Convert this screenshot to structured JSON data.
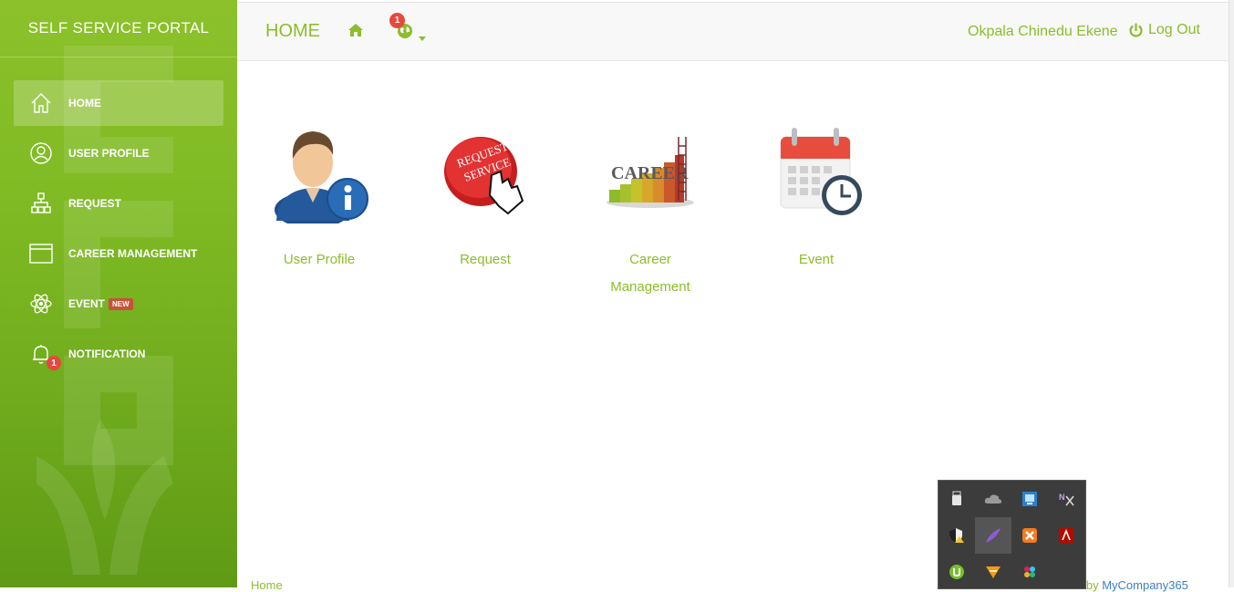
{
  "sidebar": {
    "title": "SELF SERVICE PORTAL",
    "items": [
      {
        "label": "HOME",
        "icon": "home-icon",
        "active": true
      },
      {
        "label": "USER PROFILE",
        "icon": "user-circle-icon"
      },
      {
        "label": "REQUEST",
        "icon": "sitemap-icon"
      },
      {
        "label": "CAREER MANAGEMENT",
        "icon": "window-icon"
      },
      {
        "label": "EVENT",
        "icon": "atom-icon",
        "badge": "NEW"
      },
      {
        "label": "NOTIFICATION",
        "icon": "bell-icon",
        "count": "1"
      }
    ]
  },
  "header": {
    "title": "HOME",
    "notification_count": "1",
    "username": "Okpala Chinedu Ekene",
    "logout_label": "Log Out"
  },
  "tiles": [
    {
      "label": "User Profile",
      "icon": "user-info-icon"
    },
    {
      "label": "Request",
      "icon": "request-service-icon"
    },
    {
      "label": "Career Management",
      "icon": "career-icon"
    },
    {
      "label": "Event",
      "icon": "calendar-clock-icon"
    }
  ],
  "footer": {
    "breadcrumb": "Home",
    "credit_prefix": "d by ",
    "credit_brand": "MyCompany365"
  },
  "tray_icons": [
    "usb-icon",
    "cloud-icon",
    "network-icon",
    "snipping-icon",
    "shield-warning-icon",
    "feather-icon",
    "xampp-icon",
    "adobe-icon",
    "utorrent-icon",
    "vlc-icon",
    "slack-icon"
  ],
  "colors": {
    "accent": "#8cbd2b",
    "sidebar": "#7fba24",
    "badge": "#e8473e",
    "tray": "#3c3c3c",
    "link": "#3b7fc4"
  }
}
